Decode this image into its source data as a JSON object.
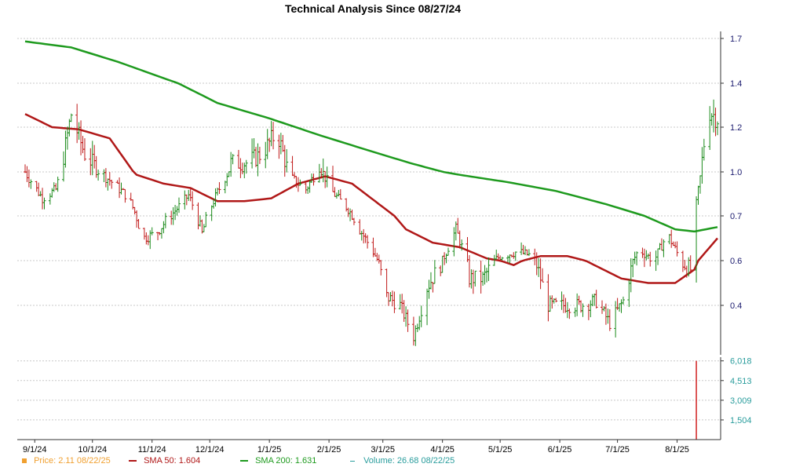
{
  "chart_data": {
    "type": "candlestick",
    "title": "Technical Analysis Since 08/27/24",
    "price_axis": {
      "ylim": [
        0.25,
        1.72
      ],
      "ticks": [
        0.4,
        0.5,
        0.7,
        1.0,
        1.2,
        1.4,
        1.7
      ],
      "tick_labels": [
        "0.4",
        "0.6",
        "0.7",
        "1.0",
        "1.2",
        "1.4",
        "1.7"
      ],
      "side": "right"
    },
    "volume_axis": {
      "ylim": [
        0,
        6300
      ],
      "ticks": [
        1504,
        3009,
        4513,
        6018
      ],
      "tick_labels": [
        "1,504",
        "3,009",
        "4,513",
        "6,018"
      ],
      "side": "right"
    },
    "x_axis": {
      "tick_labels": [
        "9/1/24",
        "10/1/24",
        "11/1/24",
        "12/1/24",
        "1/1/25",
        "2/1/25",
        "3/1/25",
        "4/1/25",
        "5/1/25",
        "6/1/25",
        "7/1/25",
        "8/1/25"
      ],
      "tick_dates": [
        "2024-09-01",
        "2024-10-01",
        "2024-11-01",
        "2024-12-01",
        "2025-01-01",
        "2025-02-01",
        "2025-03-01",
        "2025-04-01",
        "2025-05-01",
        "2025-06-01",
        "2025-07-01",
        "2025-08-01"
      ],
      "range": [
        "2024-08-27",
        "2025-08-22"
      ]
    },
    "grid": true,
    "price_series_anchors": [
      [
        "2024-08-27",
        1.0
      ],
      [
        "2024-09-05",
        0.82
      ],
      [
        "2024-09-12",
        0.88
      ],
      [
        "2024-09-20",
        1.26
      ],
      [
        "2024-09-27",
        1.08
      ],
      [
        "2024-10-05",
        1.0
      ],
      [
        "2024-10-12",
        0.92
      ],
      [
        "2024-10-20",
        0.82
      ],
      [
        "2024-10-27",
        0.6
      ],
      [
        "2024-11-03",
        0.62
      ],
      [
        "2024-11-12",
        0.72
      ],
      [
        "2024-11-20",
        0.84
      ],
      [
        "2024-11-27",
        0.62
      ],
      [
        "2024-12-05",
        0.86
      ],
      [
        "2024-12-12",
        1.04
      ],
      [
        "2024-12-20",
        1.04
      ],
      [
        "2024-12-28",
        1.08
      ],
      [
        "2025-01-05",
        1.18
      ],
      [
        "2025-01-12",
        0.96
      ],
      [
        "2025-01-20",
        0.88
      ],
      [
        "2025-01-27",
        1.04
      ],
      [
        "2025-02-03",
        0.86
      ],
      [
        "2025-02-10",
        0.76
      ],
      [
        "2025-02-17",
        0.64
      ],
      [
        "2025-02-24",
        0.54
      ],
      [
        "2025-03-03",
        0.42
      ],
      [
        "2025-03-10",
        0.4
      ],
      [
        "2025-03-17",
        0.33
      ],
      [
        "2025-03-24",
        0.44
      ],
      [
        "2025-04-01",
        0.5
      ],
      [
        "2025-04-08",
        0.64
      ],
      [
        "2025-04-15",
        0.46
      ],
      [
        "2025-04-22",
        0.46
      ],
      [
        "2025-05-01",
        0.52
      ],
      [
        "2025-05-10",
        0.54
      ],
      [
        "2025-05-18",
        0.52
      ],
      [
        "2025-05-26",
        0.4
      ],
      [
        "2025-06-03",
        0.4
      ],
      [
        "2025-06-12",
        0.4
      ],
      [
        "2025-06-20",
        0.41
      ],
      [
        "2025-06-27",
        0.36
      ],
      [
        "2025-07-04",
        0.41
      ],
      [
        "2025-07-12",
        0.55
      ],
      [
        "2025-07-20",
        0.5
      ],
      [
        "2025-07-27",
        0.62
      ],
      [
        "2025-08-03",
        0.5
      ],
      [
        "2025-08-08",
        0.48
      ],
      [
        "2025-08-11",
        0.78
      ],
      [
        "2025-08-14",
        1.05
      ],
      [
        "2025-08-17",
        1.28
      ],
      [
        "2025-08-22",
        1.24
      ]
    ],
    "sma_50": [
      [
        "2024-08-27",
        1.26
      ],
      [
        "2024-09-10",
        1.2
      ],
      [
        "2024-09-24",
        1.19
      ],
      [
        "2024-10-10",
        1.15
      ],
      [
        "2024-10-24",
        0.98
      ],
      [
        "2024-11-07",
        0.92
      ],
      [
        "2024-11-21",
        0.89
      ],
      [
        "2024-12-05",
        0.8
      ],
      [
        "2024-12-19",
        0.8
      ],
      [
        "2025-01-02",
        0.82
      ],
      [
        "2025-01-16",
        0.92
      ],
      [
        "2025-01-30",
        0.97
      ],
      [
        "2025-02-13",
        0.92
      ],
      [
        "2025-02-27",
        0.78
      ],
      [
        "2025-03-13",
        0.64
      ],
      [
        "2025-03-27",
        0.58
      ],
      [
        "2025-04-10",
        0.56
      ],
      [
        "2025-04-24",
        0.51
      ],
      [
        "2025-05-08",
        0.49
      ],
      [
        "2025-05-22",
        0.52
      ],
      [
        "2025-06-05",
        0.52
      ],
      [
        "2025-06-19",
        0.49
      ],
      [
        "2025-07-03",
        0.46
      ],
      [
        "2025-07-17",
        0.45
      ],
      [
        "2025-07-31",
        0.45
      ],
      [
        "2025-08-10",
        0.48
      ],
      [
        "2025-08-17",
        0.55
      ],
      [
        "2025-08-22",
        0.6
      ]
    ],
    "sma_200": [
      [
        "2024-08-27",
        1.68
      ],
      [
        "2024-09-20",
        1.64
      ],
      [
        "2024-10-15",
        1.54
      ],
      [
        "2024-11-10",
        1.42
      ],
      [
        "2024-12-05",
        1.31
      ],
      [
        "2025-01-01",
        1.24
      ],
      [
        "2025-01-25",
        1.17
      ],
      [
        "2025-02-20",
        1.1
      ],
      [
        "2025-03-15",
        1.04
      ],
      [
        "2025-04-10",
        0.98
      ],
      [
        "2025-05-05",
        0.93
      ],
      [
        "2025-05-30",
        0.87
      ],
      [
        "2025-06-25",
        0.78
      ],
      [
        "2025-07-15",
        0.7
      ],
      [
        "2025-07-31",
        0.64
      ],
      [
        "2025-08-10",
        0.63
      ],
      [
        "2025-08-22",
        0.65
      ]
    ],
    "volume_spike": {
      "date": "2025-08-11",
      "value": 6018
    },
    "legend": [
      {
        "name": "Price: 2.11  08/22/25",
        "color": "#f0a030",
        "swatch": "square"
      },
      {
        "name": "SMA 50: 1.604",
        "color": "#b01818",
        "swatch": "line"
      },
      {
        "name": "SMA 200: 1.631",
        "color": "#1e9a1e",
        "swatch": "line"
      },
      {
        "name": "Volume: 26.68  08/22/25",
        "color": "#2a9d9d",
        "swatch": "tick"
      }
    ],
    "colors": {
      "up": "#1a8a1a",
      "down": "#c01818",
      "sma50": "#b01818",
      "sma200": "#1e9a1e",
      "volume": "#d02020",
      "axis": "#333333",
      "price_ticks": "#1a1a6e",
      "volume_ticks": "#2a9d9d"
    }
  }
}
